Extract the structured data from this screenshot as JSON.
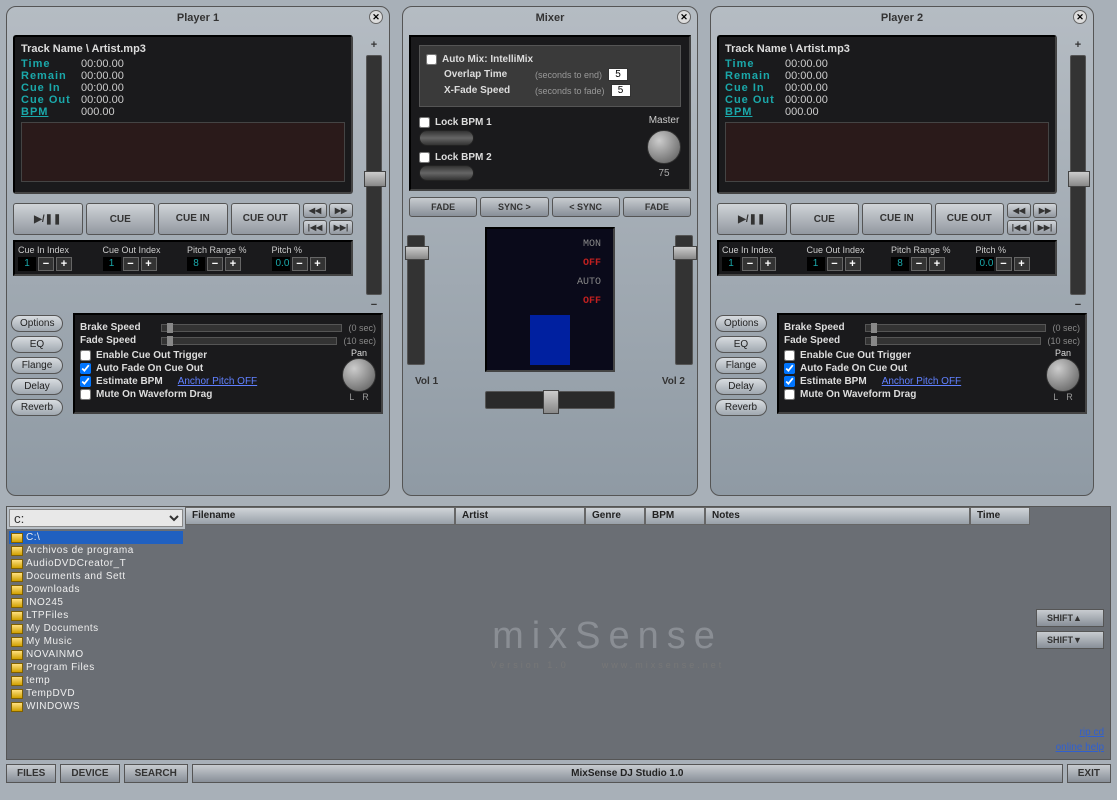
{
  "player1": {
    "title": "Player 1",
    "track": "Track Name \\ Artist.mp3",
    "time_l": "Time",
    "time_v": "00:00.00",
    "remain_l": "Remain",
    "remain_v": "00:00.00",
    "cuein_l": "Cue In",
    "cuein_v": "00:00.00",
    "cueout_l": "Cue Out",
    "cueout_v": "00:00.00",
    "bpm_l": "BPM",
    "bpm_v": "000.00",
    "play": "▶/❚❚",
    "cue": "CUE",
    "cuein_b": "CUE IN",
    "cueout_b": "CUE OUT",
    "cue_in_idx_l": "Cue In Index",
    "cue_in_idx": "1",
    "cue_out_idx_l": "Cue Out Index",
    "cue_out_idx": "1",
    "pitch_range_l": "Pitch Range %",
    "pitch_range": "8",
    "pitch_l": "Pitch %",
    "pitch": "0.0",
    "options": "Options",
    "eq": "EQ",
    "flange": "Flange",
    "delay": "Delay",
    "reverb": "Reverb",
    "brake_l": "Brake Speed",
    "brake_sec": "(0 sec)",
    "fade_l": "Fade Speed",
    "fade_sec": "(10 sec)",
    "chk1": "Enable Cue Out Trigger",
    "chk2": "Auto Fade On Cue Out",
    "chk3": "Estimate BPM",
    "anchor": "Anchor Pitch OFF",
    "chk4": "Mute On Waveform Drag",
    "pan": "Pan",
    "L": "L",
    "R": "R"
  },
  "mixer": {
    "title": "Mixer",
    "auto": "Auto Mix: IntelliMix",
    "overlap_l": "Overlap Time",
    "overlap_h": "(seconds to end)",
    "overlap_v": "5",
    "xfade_l": "X-Fade Speed",
    "xfade_h": "(seconds to fade)",
    "xfade_v": "5",
    "lock1": "Lock BPM 1",
    "lock2": "Lock BPM 2",
    "master_l": "Master",
    "master_v": "75",
    "fade": "FADE",
    "sync_r": "SYNC >",
    "sync_l": "< SYNC",
    "mon_l": "MON",
    "mon_v": "OFF",
    "auto_l": "AUTO",
    "auto_v": "OFF",
    "vol1": "Vol 1",
    "vol2": "Vol 2"
  },
  "player2": {
    "title": "Player 2",
    "track": "Track Name \\ Artist.mp3",
    "time_l": "Time",
    "time_v": "00:00.00",
    "remain_l": "Remain",
    "remain_v": "00:00.00",
    "cuein_l": "Cue In",
    "cuein_v": "00:00.00",
    "cueout_l": "Cue Out",
    "cueout_v": "00:00.00",
    "bpm_l": "BPM",
    "bpm_v": "000.00",
    "play": "▶/❚❚",
    "cue": "CUE",
    "cuein_b": "CUE IN",
    "cueout_b": "CUE OUT",
    "cue_in_idx_l": "Cue In Index",
    "cue_in_idx": "1",
    "cue_out_idx_l": "Cue Out Index",
    "cue_out_idx": "1",
    "pitch_range_l": "Pitch Range %",
    "pitch_range": "8",
    "pitch_l": "Pitch %",
    "pitch": "0.0",
    "options": "Options",
    "eq": "EQ",
    "flange": "Flange",
    "delay": "Delay",
    "reverb": "Reverb",
    "brake_l": "Brake Speed",
    "brake_sec": "(0 sec)",
    "fade_l": "Fade Speed",
    "fade_sec": "(10 sec)",
    "chk1": "Enable Cue Out Trigger",
    "chk2": "Auto Fade On Cue Out",
    "chk3": "Estimate BPM",
    "anchor": "Anchor Pitch OFF",
    "chk4": "Mute On Waveform Drag",
    "pan": "Pan",
    "L": "L",
    "R": "R"
  },
  "browser": {
    "drive": "c:",
    "cols": {
      "file": "Filename",
      "artist": "Artist",
      "genre": "Genre",
      "bpm": "BPM",
      "notes": "Notes",
      "time": "Time"
    },
    "tree": [
      "C:\\",
      "Archivos de programa",
      "AudioDVDCreator_T",
      "Documents and Sett",
      "Downloads",
      "INO245",
      "LTPFiles",
      "My Documents",
      "My Music",
      "NOVAINMO",
      "Program Files",
      "temp",
      "TempDVD",
      "WINDOWS"
    ],
    "logo": "mixSense",
    "ver": "Version 1.0",
    "url": "www.mixsense.net",
    "shift_up": "SHIFT▲",
    "shift_dn": "SHIFT▼",
    "rip": "rip cd",
    "help": "online help"
  },
  "footer": {
    "files": "FILES",
    "device": "DEVICE",
    "search": "SEARCH",
    "title": "MixSense DJ Studio 1.0",
    "exit": "EXIT"
  }
}
